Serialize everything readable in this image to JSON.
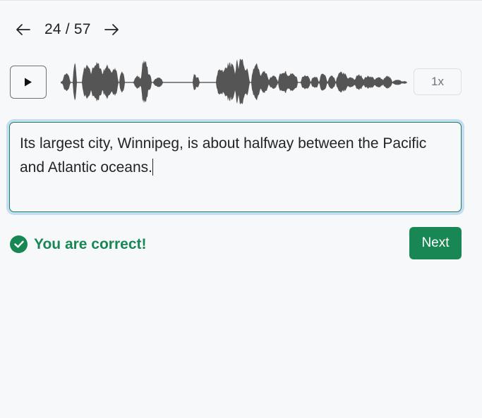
{
  "navigation": {
    "prev_icon": "arrow-left-icon",
    "counter": "24 / 57",
    "next_icon": "arrow-right-icon"
  },
  "player": {
    "play_icon": "play-icon",
    "speed_label": "1x"
  },
  "answer": {
    "text": "Its largest city, Winnipeg, is about halfway between the Pacific and Atlantic oceans."
  },
  "feedback": {
    "icon": "check-circle-icon",
    "message": "You are correct!"
  },
  "actions": {
    "next_label": "Next"
  },
  "colors": {
    "success": "#198754",
    "waveform": "#555555",
    "focus_ring": "#c5dcf3"
  }
}
